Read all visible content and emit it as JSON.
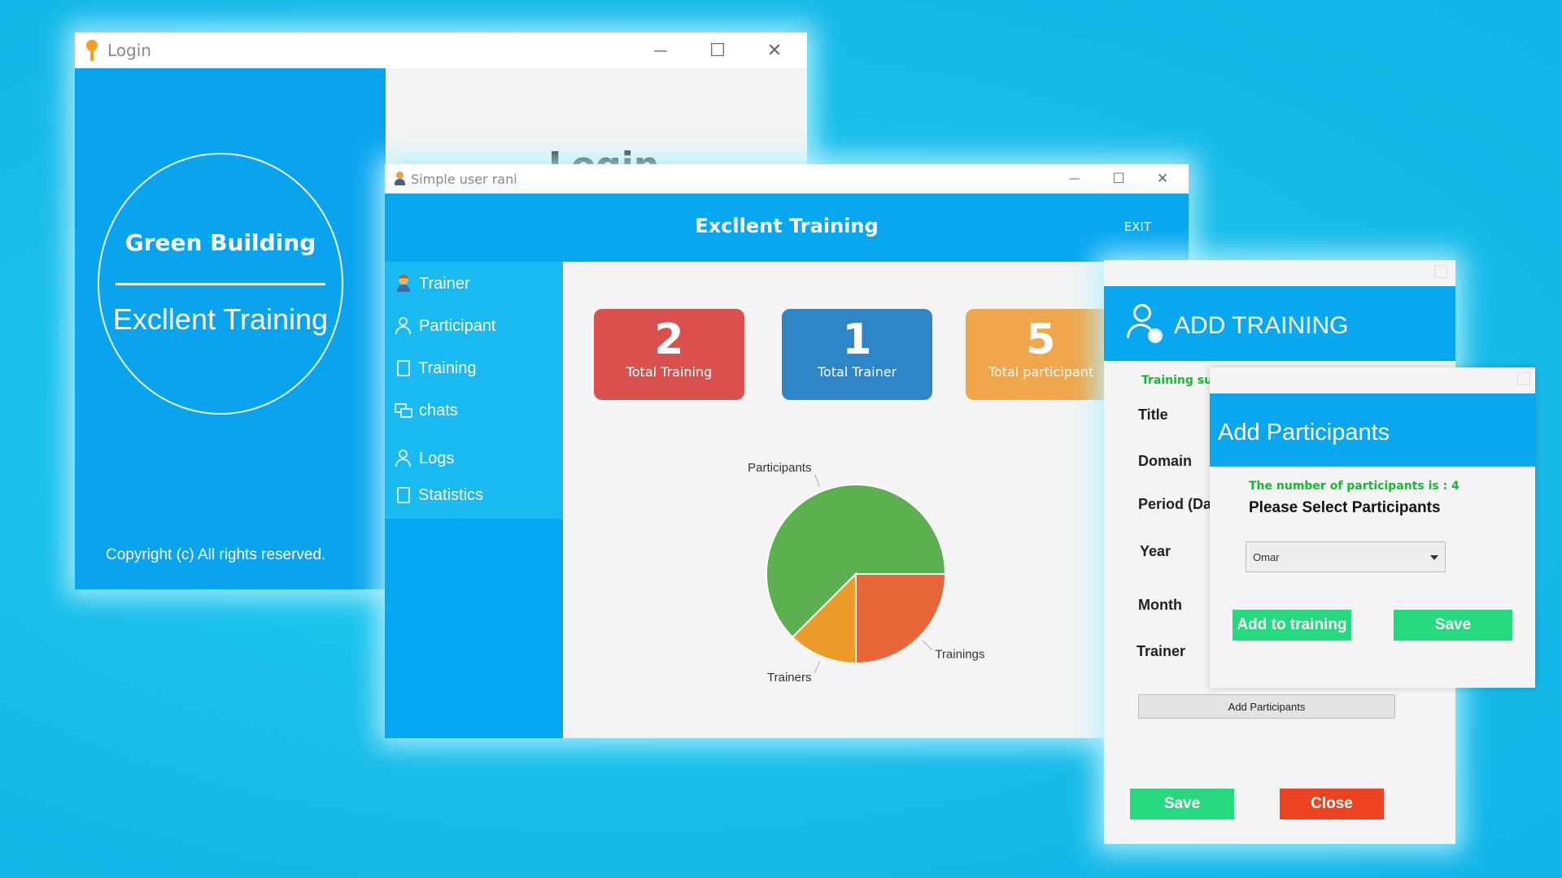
{
  "login_window": {
    "title": "Login",
    "brand": "Green Building",
    "subtitle": "Excllent Training",
    "copyright": "Copyright (c)  All rights reserved.",
    "heading": "Login",
    "controls": {
      "minimize": "—",
      "maximize": "☐",
      "close": "✕"
    }
  },
  "dashboard_window": {
    "title": "Simple user rani",
    "app_title": "Excllent Training",
    "exit_label": "EXIT",
    "controls": {
      "minimize": "—",
      "maximize": "☐",
      "close": "✕"
    },
    "sidebar": [
      {
        "label": "Trainer",
        "icon": "trainer-icon"
      },
      {
        "label": "Participant",
        "icon": "person-icon"
      },
      {
        "label": "Training",
        "icon": "document-icon"
      },
      {
        "label": "chats",
        "icon": "chat-icon"
      },
      {
        "label": "Logs",
        "icon": "logs-icon"
      },
      {
        "label": "Statistics",
        "icon": "document-icon"
      }
    ],
    "cards": [
      {
        "value": "2",
        "label": "Total Training",
        "color": "#d9504f"
      },
      {
        "value": "1",
        "label": "Total Trainer",
        "color": "#2e86c6"
      },
      {
        "value": "5",
        "label": "Total participant",
        "color": "#f0a64a"
      }
    ]
  },
  "chart_data": {
    "type": "pie",
    "slices": [
      {
        "label": "Participants",
        "value": 5,
        "color": "#5cb04f"
      },
      {
        "label": "Trainings",
        "value": 2,
        "color": "#e8673a"
      },
      {
        "label": "Trainers",
        "value": 1,
        "color": "#eb9b2a"
      }
    ]
  },
  "add_training_window": {
    "title": "ADD TRAINING",
    "success_message": "Training succ",
    "fields": [
      "Title",
      "Domain",
      "Period (Day",
      "Year",
      "Month",
      "Trainer"
    ],
    "add_participants_button": "Add Participants",
    "save_button": "Save",
    "close_button": "Close"
  },
  "add_participants_dialog": {
    "title": "Add Participants",
    "count_text": "The number of participants is : 4",
    "prompt": "Please Select Participants",
    "selected_participant": "Omar",
    "add_button": "Add to training",
    "save_button": "Save"
  }
}
